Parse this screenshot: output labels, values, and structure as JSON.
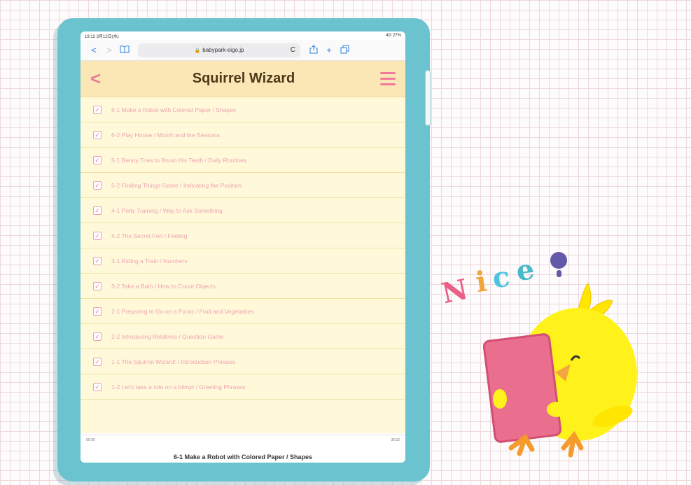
{
  "statusbar": {
    "left": "19:12  3月12日(水)",
    "right": "4G 27%"
  },
  "browser": {
    "url": "babypark-eigo.jp",
    "back": "<",
    "forward": ">",
    "bookmarks": "bookmarks-icon",
    "reload": "C",
    "share": "share-icon",
    "new_tab": "+",
    "tabs": "tabs-icon"
  },
  "header": {
    "title": "Squirrel Wizard",
    "back": "<"
  },
  "lessons": [
    "6-1 Make a Robot with Colored Paper / Shapes",
    "6-2 Play House / Month and the Seasons",
    "5-1 Benny Tries to Brush His Teeth / Daily Routines",
    "5-2 Finding Things Game / Indicating the Position",
    "4-1 Potty Training / Way to Ask Something",
    "4-2 The Secret Fort / Feeling",
    "3-1 Riding a Train / Numbers",
    "3-2 Take a Bath / How to Count Objects",
    "2-1 Preparing to Go on a Picnic / Fruit and Vegetables",
    "2-2 Introducing Relatives / Question Game",
    "1-1 The Squirrel Wizard! / Introduction Phrases",
    "1-2 Let's take a ride on a blimp! / Greeting Phrases"
  ],
  "player": {
    "elapsed": "00:00",
    "duration": "35:32",
    "now_playing": "6-1 Make a Robot with Colored Paper / Shapes"
  },
  "decoration": {
    "nice_text": "Nice!"
  },
  "colors": {
    "frame": "#6bc3cf",
    "header": "#fbe7b5",
    "list": "#fff9d9",
    "accent": "#ee7b9c"
  }
}
